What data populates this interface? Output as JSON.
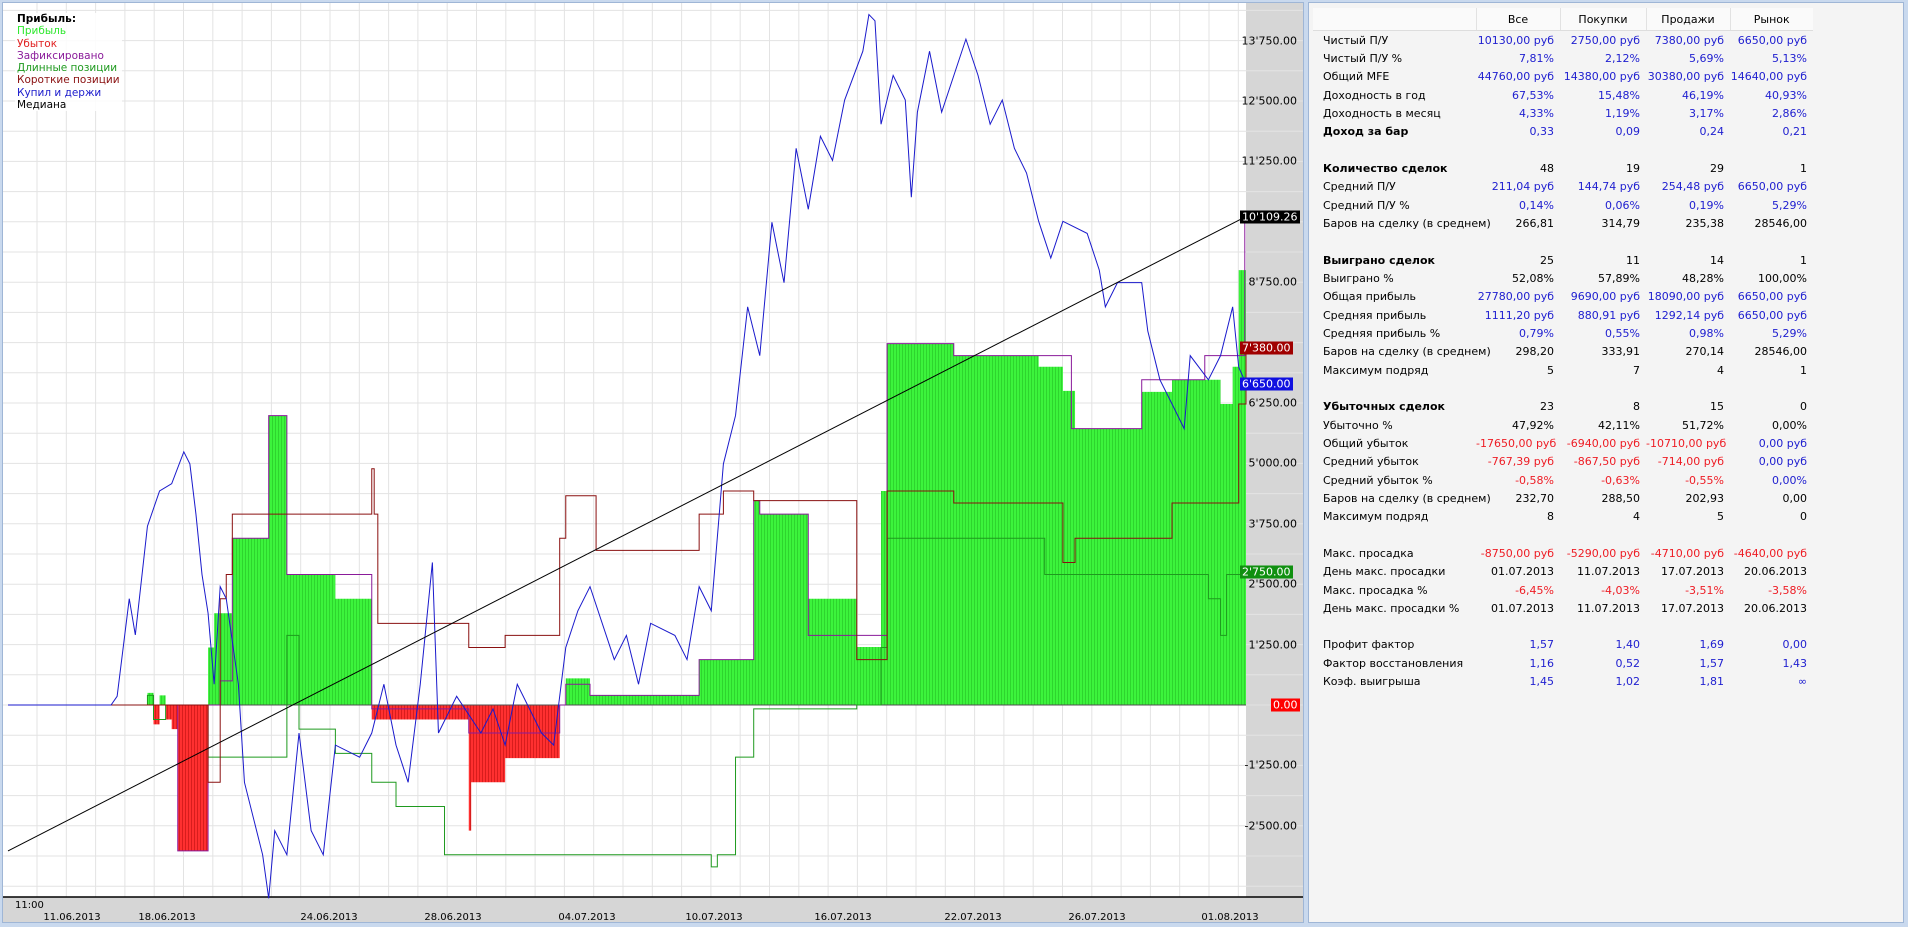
{
  "legend": {
    "title": "Прибыль:",
    "items": [
      {
        "label": "Прибыль",
        "color": "#2ee82e"
      },
      {
        "label": "Убыток",
        "color": "#e02020"
      },
      {
        "label": "Зафиксировано",
        "color": "#8a1a9a"
      },
      {
        "label": "Длинные позиции",
        "color": "#1f9a1f"
      },
      {
        "label": "Короткие позиции",
        "color": "#8a1010"
      },
      {
        "label": "Купил и держи",
        "color": "#1a1acc"
      },
      {
        "label": "Медиана",
        "color": "#000000"
      }
    ]
  },
  "chart_data": {
    "type": "line",
    "title": "Прибыль",
    "x_unit": "bar index",
    "xlim": [
      0,
      1021
    ],
    "ylim": [
      -3400,
      14300
    ],
    "grid": true,
    "legend_position": "top-left",
    "time_label": "11:00",
    "x_tick_labels": [
      "11.06.2013",
      "18.06.2013",
      "24.06.2013",
      "28.06.2013",
      "04.07.2013",
      "10.07.2013",
      "16.07.2013",
      "22.07.2013",
      "26.07.2013",
      "01.08.2013"
    ],
    "y_ticks": [
      -2500,
      -1250,
      1250,
      2500,
      3750,
      5000,
      6250,
      8750,
      11250,
      12500,
      13750
    ],
    "y_tick_labels": [
      "-2'500.00",
      "-1'250.00",
      "1'250.00",
      "2'500.00",
      "3'750.00",
      "5'000.00",
      "6'250.00",
      "8'750.00",
      "11'250.00",
      "12'500.00",
      "13'750.00"
    ],
    "last_value_badges": [
      {
        "label": "10'109.26",
        "value": 10109.26,
        "color": "#000000"
      },
      {
        "label": "7'380.00",
        "value": 7380,
        "color": "#a00000"
      },
      {
        "label": "6'650.00",
        "value": 6650,
        "color": "#1010e0"
      },
      {
        "label": "2'750.00",
        "value": 2750,
        "color": "#109010"
      },
      {
        "label": "0.00",
        "value": 0,
        "color": "#ff0000"
      }
    ],
    "series": [
      {
        "name": "Прибыль",
        "kind": "area",
        "x": [
          0,
          110,
          115,
          120,
          125,
          130,
          135,
          140,
          165,
          170,
          185,
          215,
          230,
          240,
          270,
          300,
          380,
          382,
          410,
          455,
          460,
          480,
          570,
          615,
          620,
          660,
          700,
          720,
          725,
          780,
          850,
          870,
          880,
          935,
          960,
          990,
          1000,
          1010,
          1015,
          1021
        ],
        "y": [
          0,
          0,
          250,
          -400,
          200,
          -300,
          -500,
          -3020,
          1190,
          1900,
          3450,
          5990,
          2700,
          2700,
          2200,
          -300,
          -2600,
          -1600,
          -1100,
          0,
          550,
          200,
          940,
          4230,
          3950,
          2200,
          1200,
          4430,
          7480,
          7230,
          7000,
          6500,
          5720,
          6480,
          6730,
          6730,
          6230,
          7000,
          9000,
          10109
        ]
      },
      {
        "name": "Зафиксировано",
        "kind": "step",
        "x": [
          0,
          140,
          165,
          175,
          185,
          215,
          230,
          300,
          380,
          455,
          460,
          480,
          570,
          615,
          620,
          660,
          725,
          780,
          877,
          935,
          987,
          1020,
          1021
        ],
        "y": [
          0,
          -3020,
          0,
          500,
          3450,
          5990,
          2700,
          -80,
          -580,
          0,
          430,
          200,
          940,
          4230,
          3950,
          1440,
          7480,
          7230,
          5720,
          6730,
          7230,
          10109,
          10109
        ]
      },
      {
        "name": "Длинные позиции",
        "kind": "step",
        "x": [
          0,
          110,
          115,
          120,
          130,
          165,
          225,
          230,
          240,
          270,
          300,
          320,
          360,
          580,
          585,
          600,
          615,
          700,
          720,
          725,
          855,
          960,
          990,
          1000,
          1005,
          1021
        ],
        "y": [
          0,
          0,
          200,
          -300,
          0,
          -1080,
          -1080,
          1440,
          -500,
          -1000,
          -1600,
          -2100,
          -3100,
          -3350,
          -3100,
          -1080,
          -80,
          0,
          1190,
          3450,
          2700,
          2700,
          2200,
          1440,
          2700,
          2750
        ]
      },
      {
        "name": "Короткие позиции",
        "kind": "step",
        "x": [
          0,
          160,
          165,
          175,
          180,
          185,
          300,
          302,
          305,
          380,
          410,
          455,
          460,
          485,
          570,
          590,
          615,
          700,
          725,
          780,
          870,
          880,
          940,
          960,
          1015,
          1021
        ],
        "y": [
          0,
          0,
          -1600,
          2200,
          2700,
          3950,
          4890,
          3950,
          1690,
          1190,
          1440,
          3450,
          4330,
          3200,
          3950,
          4430,
          4230,
          940,
          4430,
          4180,
          2950,
          3450,
          3450,
          4180,
          6230,
          7380
        ]
      },
      {
        "name": "Купил и держи",
        "kind": "line",
        "x": [
          0,
          85,
          90,
          100,
          105,
          115,
          125,
          135,
          145,
          150,
          155,
          160,
          165,
          170,
          175,
          180,
          190,
          195,
          205,
          210,
          215,
          220,
          230,
          240,
          250,
          260,
          270,
          290,
          300,
          310,
          320,
          330,
          340,
          350,
          355,
          370,
          390,
          400,
          410,
          420,
          440,
          450,
          460,
          470,
          480,
          500,
          510,
          520,
          530,
          550,
          560,
          570,
          580,
          590,
          600,
          610,
          620,
          630,
          640,
          650,
          660,
          670,
          680,
          690,
          705,
          710,
          715,
          720,
          730,
          740,
          745,
          750,
          760,
          770,
          790,
          800,
          810,
          820,
          830,
          840,
          850,
          860,
          870,
          890,
          900,
          905,
          915,
          935,
          940,
          950,
          960,
          970,
          975,
          990,
          1000,
          1010,
          1015,
          1021
        ],
        "y": [
          0,
          0,
          180,
          2200,
          1450,
          3700,
          4430,
          4580,
          5240,
          4990,
          3950,
          2700,
          1900,
          430,
          2450,
          2200,
          430,
          -1600,
          -2600,
          -3100,
          -4000,
          -2600,
          -3100,
          -580,
          -2600,
          -3100,
          -830,
          -1080,
          -580,
          430,
          -830,
          -1600,
          430,
          2950,
          -580,
          180,
          -580,
          -80,
          -830,
          430,
          -580,
          -830,
          1190,
          1950,
          2450,
          940,
          1440,
          430,
          1690,
          1440,
          940,
          2450,
          1950,
          4990,
          5990,
          8240,
          7230,
          9990,
          8740,
          11520,
          10260,
          11770,
          11270,
          12520,
          13530,
          14290,
          14160,
          12020,
          13030,
          12520,
          10510,
          12270,
          13530,
          12270,
          13780,
          13030,
          12020,
          12520,
          11520,
          11010,
          10010,
          9250,
          10010,
          9760,
          9000,
          8240,
          8740,
          8740,
          7740,
          6730,
          6230,
          5720,
          7230,
          6730,
          7230,
          8240,
          6990,
          6650
        ]
      },
      {
        "name": "Медиана",
        "kind": "line",
        "x": [
          0,
          1021
        ],
        "y": [
          -3020,
          10109.26
        ]
      }
    ]
  },
  "stats": {
    "columns": [
      "Все",
      "Покупки",
      "Продажи",
      "Рынок"
    ],
    "colors": {
      "b": "#2020d0",
      "r": "#ee1c24",
      "k": "#000000"
    },
    "rows": [
      {
        "label": "Чистый П/У",
        "values": [
          "10130,00 руб",
          "2750,00 руб",
          "7380,00 руб",
          "6650,00 руб"
        ],
        "tones": "bbbb"
      },
      {
        "label": "Чистый П/У %",
        "values": [
          "7,81%",
          "2,12%",
          "5,69%",
          "5,13%"
        ],
        "tones": "bbbb"
      },
      {
        "label": "Общий MFE",
        "values": [
          "44760,00 руб",
          "14380,00 руб",
          "30380,00 руб",
          "14640,00 руб"
        ],
        "tones": "bbbb"
      },
      {
        "label": "Доходность в год",
        "values": [
          "67,53%",
          "15,48%",
          "46,19%",
          "40,93%"
        ],
        "tones": "bbbb"
      },
      {
        "label": "Доходность в месяц",
        "values": [
          "4,33%",
          "1,19%",
          "3,17%",
          "2,86%"
        ],
        "tones": "bbbb"
      },
      {
        "label": "Доход за бар",
        "bold": true,
        "values": [
          "0,33",
          "0,09",
          "0,24",
          "0,21"
        ],
        "tones": "bbbb"
      },
      {
        "blank": true
      },
      {
        "label": "Количество сделок",
        "bold": true,
        "values": [
          "48",
          "19",
          "29",
          "1"
        ],
        "tones": "kkkk"
      },
      {
        "label": "Средний П/У",
        "values": [
          "211,04 руб",
          "144,74 руб",
          "254,48 руб",
          "6650,00 руб"
        ],
        "tones": "bbbb"
      },
      {
        "label": "Средний П/У %",
        "values": [
          "0,14%",
          "0,06%",
          "0,19%",
          "5,29%"
        ],
        "tones": "bbbb"
      },
      {
        "label": "Баров на сделку (в среднем)",
        "values": [
          "266,81",
          "314,79",
          "235,38",
          "28546,00"
        ],
        "tones": "kkkk"
      },
      {
        "blank": true
      },
      {
        "label": "Выиграно сделок",
        "bold": true,
        "values": [
          "25",
          "11",
          "14",
          "1"
        ],
        "tones": "kkkk"
      },
      {
        "label": "Выиграно %",
        "values": [
          "52,08%",
          "57,89%",
          "48,28%",
          "100,00%"
        ],
        "tones": "kkkk"
      },
      {
        "label": "Общая прибыль",
        "values": [
          "27780,00 руб",
          "9690,00 руб",
          "18090,00 руб",
          "6650,00 руб"
        ],
        "tones": "bbbb"
      },
      {
        "label": "Средняя прибыль",
        "values": [
          "1111,20 руб",
          "880,91 руб",
          "1292,14 руб",
          "6650,00 руб"
        ],
        "tones": "bbbb"
      },
      {
        "label": "Средняя прибыль %",
        "values": [
          "0,79%",
          "0,55%",
          "0,98%",
          "5,29%"
        ],
        "tones": "bbbb"
      },
      {
        "label": "Баров на сделку (в среднем)",
        "values": [
          "298,20",
          "333,91",
          "270,14",
          "28546,00"
        ],
        "tones": "kkkk"
      },
      {
        "label": "Максимум подряд",
        "values": [
          "5",
          "7",
          "4",
          "1"
        ],
        "tones": "kkkk"
      },
      {
        "blank": true
      },
      {
        "label": "Убыточных сделок",
        "bold": true,
        "values": [
          "23",
          "8",
          "15",
          "0"
        ],
        "tones": "kkkk"
      },
      {
        "label": "Убыточно %",
        "values": [
          "47,92%",
          "42,11%",
          "51,72%",
          "0,00%"
        ],
        "tones": "kkkk"
      },
      {
        "label": "Общий убыток",
        "values": [
          "-17650,00 руб",
          "-6940,00 руб",
          "-10710,00 руб",
          "0,00 руб"
        ],
        "tones": "rrrb"
      },
      {
        "label": "Средний убыток",
        "values": [
          "-767,39 руб",
          "-867,50 руб",
          "-714,00 руб",
          "0,00 руб"
        ],
        "tones": "rrrb"
      },
      {
        "label": "Средний убыток %",
        "values": [
          "-0,58%",
          "-0,63%",
          "-0,55%",
          "0,00%"
        ],
        "tones": "rrrb"
      },
      {
        "label": "Баров на сделку (в среднем)",
        "values": [
          "232,70",
          "288,50",
          "202,93",
          "0,00"
        ],
        "tones": "kkkk"
      },
      {
        "label": "Максимум подряд",
        "values": [
          "8",
          "4",
          "5",
          "0"
        ],
        "tones": "kkkk"
      },
      {
        "blank": true
      },
      {
        "label": "Макс. просадка",
        "values": [
          "-8750,00 руб",
          "-5290,00 руб",
          "-4710,00 руб",
          "-4640,00 руб"
        ],
        "tones": "rrrr"
      },
      {
        "label": "День макс. просадки",
        "values": [
          "01.07.2013",
          "11.07.2013",
          "17.07.2013",
          "20.06.2013"
        ],
        "tones": "kkkk"
      },
      {
        "label": "Макс. просадка %",
        "values": [
          "-6,45%",
          "-4,03%",
          "-3,51%",
          "-3,58%"
        ],
        "tones": "rrrr"
      },
      {
        "label": "День макс. просадки %",
        "values": [
          "01.07.2013",
          "11.07.2013",
          "17.07.2013",
          "20.06.2013"
        ],
        "tones": "kkkk"
      },
      {
        "blank": true
      },
      {
        "label": "Профит фактор",
        "values": [
          "1,57",
          "1,40",
          "1,69",
          "0,00"
        ],
        "tones": "bbbb"
      },
      {
        "label": "Фактор восстановления",
        "values": [
          "1,16",
          "0,52",
          "1,57",
          "1,43"
        ],
        "tones": "bbbb"
      },
      {
        "label": "Коэф. выигрыша",
        "values": [
          "1,45",
          "1,02",
          "1,81",
          "∞"
        ],
        "tones": "bbbb"
      }
    ]
  }
}
